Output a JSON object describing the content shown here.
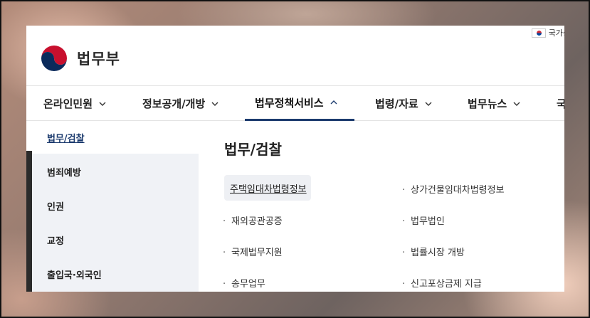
{
  "header": {
    "logo_text": "법무부",
    "util_link": "국가상"
  },
  "gnb": {
    "items": [
      {
        "label": "온라인민원"
      },
      {
        "label": "정보공개/개방"
      },
      {
        "label": "법무정책서비스"
      },
      {
        "label": "법령/자료"
      },
      {
        "label": "법무뉴스"
      },
      {
        "label": "국"
      }
    ],
    "active_index": 2
  },
  "submenu": {
    "side_items": [
      {
        "label": "법무/검찰"
      },
      {
        "label": "범죄예방"
      },
      {
        "label": "인권"
      },
      {
        "label": "교정"
      },
      {
        "label": "출입국·외국인"
      }
    ],
    "content_title": "법무/검찰",
    "links_left": [
      {
        "label": "주택임대차법령정보"
      },
      {
        "label": "재외공관공증"
      },
      {
        "label": "국제법무지원"
      },
      {
        "label": "송무업무"
      }
    ],
    "links_right": [
      {
        "label": "상가건물임대차법령정보"
      },
      {
        "label": "법무법인"
      },
      {
        "label": "법률시장 개방"
      },
      {
        "label": "신고포상금제 지급"
      }
    ]
  },
  "colors": {
    "accent": "#1c3b6e",
    "sidebar_bg": "#f0f2f6"
  }
}
